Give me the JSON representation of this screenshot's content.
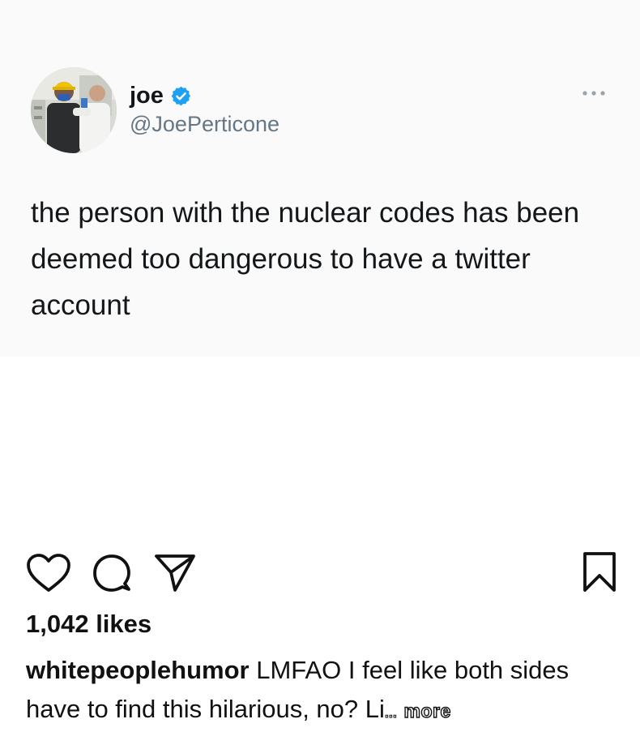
{
  "tweet": {
    "display_name": "joe",
    "verified": true,
    "handle": "@JoePerticone",
    "text": "the person with the nuclear codes has been deemed too dangerous to have a twitter account",
    "icons": {
      "avatar": "profile-photo",
      "verified": "verified-badge-icon",
      "more": "more-dots-icon"
    },
    "colors": {
      "verified": "#1da1f2",
      "handle": "#657786"
    }
  },
  "post": {
    "actions": [
      "heart-icon",
      "comment-icon",
      "share-icon",
      "bookmark-icon"
    ],
    "likes": "1,042 likes",
    "caption": {
      "username": "whitepeoplehumor",
      "text": "LMFAO I feel like both sides have to find this hilarious, no? Li",
      "ellipsis": "...",
      "more_label": "more"
    }
  }
}
